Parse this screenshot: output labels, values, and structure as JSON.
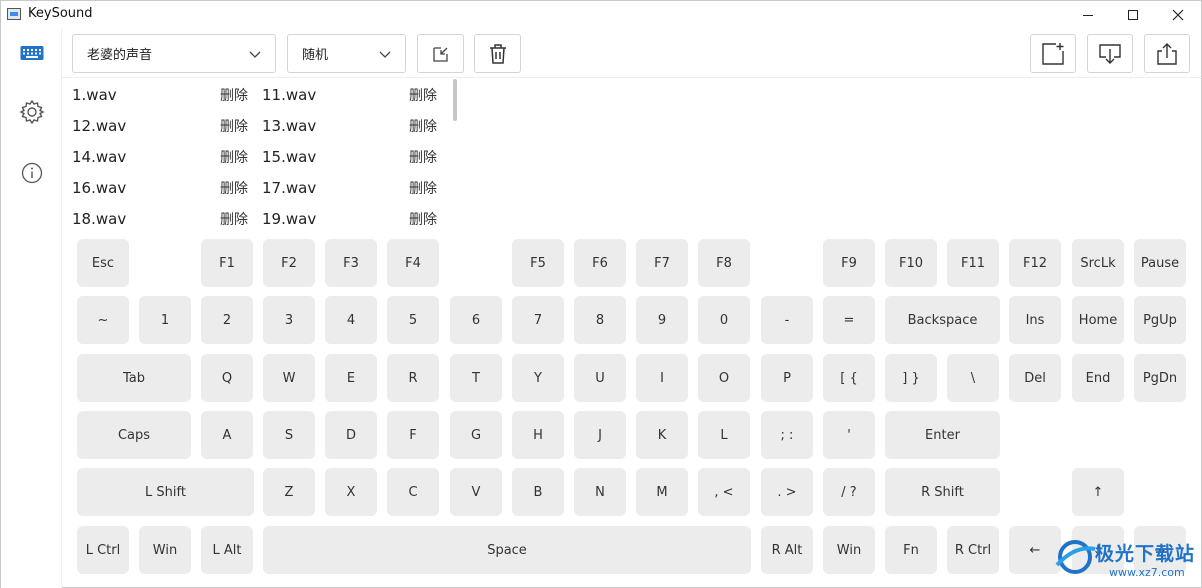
{
  "window": {
    "title": "KeySound"
  },
  "toolbar": {
    "sound_select": "老婆的声音",
    "mode_select": "随机",
    "icons": [
      "open-folder-icon",
      "trash-icon",
      "new-file-icon",
      "import-icon",
      "export-icon"
    ]
  },
  "sidebar": {
    "icons": [
      "keyboard-icon",
      "settings-gear-icon",
      "info-icon"
    ]
  },
  "files": {
    "delete_label": "删除",
    "left": [
      "1.wav",
      "12.wav",
      "14.wav",
      "16.wav",
      "18.wav"
    ],
    "right": [
      "11.wav",
      "13.wav",
      "15.wav",
      "17.wav",
      "19.wav"
    ]
  },
  "keyboard": {
    "row1": [
      "Esc",
      "F1",
      "F2",
      "F3",
      "F4",
      "F5",
      "F6",
      "F7",
      "F8",
      "F9",
      "F10",
      "F11",
      "F12",
      "SrcLk",
      "Pause"
    ],
    "row2": [
      "~",
      "1",
      "2",
      "3",
      "4",
      "5",
      "6",
      "7",
      "8",
      "9",
      "0",
      "-",
      "=",
      "Backspace",
      "Ins",
      "Home",
      "PgUp"
    ],
    "row3": [
      "Tab",
      "Q",
      "W",
      "E",
      "R",
      "T",
      "Y",
      "U",
      "I",
      "O",
      "P",
      "[ {",
      "] }",
      "\\",
      "Del",
      "End",
      "PgDn"
    ],
    "row4": [
      "Caps",
      "A",
      "S",
      "D",
      "F",
      "G",
      "H",
      "J",
      "K",
      "L",
      "; :",
      "'",
      "Enter"
    ],
    "row5": [
      "L Shift",
      "Z",
      "X",
      "C",
      "V",
      "B",
      "N",
      "M",
      ", <",
      ". >",
      "/ ?",
      "R Shift",
      "↑"
    ],
    "row6": [
      "L Ctrl",
      "Win",
      "L Alt",
      "Space",
      "R Alt",
      "Win",
      "Fn",
      "R Ctrl",
      "←",
      "↓",
      "→"
    ]
  },
  "watermark": {
    "name": "极光下载站",
    "url": "www.xz7.com"
  },
  "colors": {
    "accent": "#1f73c8",
    "key_bg": "#ececec"
  }
}
